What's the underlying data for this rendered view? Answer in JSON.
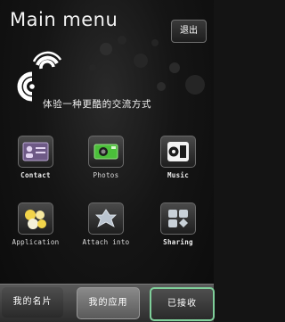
{
  "header": {
    "title": "Main menu",
    "exit_label": "退出"
  },
  "banner": {
    "tagline": "体验一种更酷的交流方式"
  },
  "grid": {
    "items": [
      {
        "label": "Contact",
        "icon": "contact-card-icon"
      },
      {
        "label": "Photos",
        "icon": "photos-icon"
      },
      {
        "label": "Music",
        "icon": "music-icon"
      },
      {
        "label": "Application",
        "icon": "application-icon"
      },
      {
        "label": "Attach into",
        "icon": "attach-icon"
      },
      {
        "label": "Sharing",
        "icon": "sharing-icon"
      }
    ]
  },
  "tabs": [
    {
      "label": "我的名片"
    },
    {
      "label": "我的应用"
    },
    {
      "label": "已接收"
    }
  ],
  "colors": {
    "accent": "#7fcf9a",
    "photos_green": "#4bbf3a"
  }
}
